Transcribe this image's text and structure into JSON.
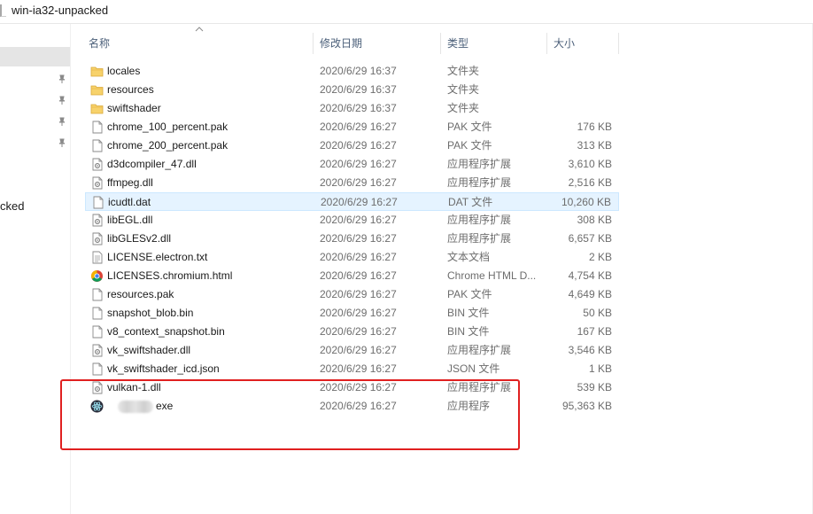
{
  "window": {
    "title": "win-ia32-unpacked"
  },
  "nav": {
    "partial_label": "cked"
  },
  "columns": {
    "name": "名称",
    "date": "修改日期",
    "type": "类型",
    "size": "大小"
  },
  "files": [
    {
      "name": "locales",
      "date": "2020/6/29 16:37",
      "type": "文件夹",
      "size": "",
      "icon": "folder-icon"
    },
    {
      "name": "resources",
      "date": "2020/6/29 16:37",
      "type": "文件夹",
      "size": "",
      "icon": "folder-icon"
    },
    {
      "name": "swiftshader",
      "date": "2020/6/29 16:37",
      "type": "文件夹",
      "size": "",
      "icon": "folder-icon"
    },
    {
      "name": "chrome_100_percent.pak",
      "date": "2020/6/29 16:27",
      "type": "PAK 文件",
      "size": "176 KB",
      "icon": "file-icon"
    },
    {
      "name": "chrome_200_percent.pak",
      "date": "2020/6/29 16:27",
      "type": "PAK 文件",
      "size": "313 KB",
      "icon": "file-icon"
    },
    {
      "name": "d3dcompiler_47.dll",
      "date": "2020/6/29 16:27",
      "type": "应用程序扩展",
      "size": "3,610 KB",
      "icon": "dll-icon"
    },
    {
      "name": "ffmpeg.dll",
      "date": "2020/6/29 16:27",
      "type": "应用程序扩展",
      "size": "2,516 KB",
      "icon": "dll-icon"
    },
    {
      "name": "icudtl.dat",
      "date": "2020/6/29 16:27",
      "type": "DAT 文件",
      "size": "10,260 KB",
      "icon": "file-icon"
    },
    {
      "name": "libEGL.dll",
      "date": "2020/6/29 16:27",
      "type": "应用程序扩展",
      "size": "308 KB",
      "icon": "dll-icon"
    },
    {
      "name": "libGLESv2.dll",
      "date": "2020/6/29 16:27",
      "type": "应用程序扩展",
      "size": "6,657 KB",
      "icon": "dll-icon"
    },
    {
      "name": "LICENSE.electron.txt",
      "date": "2020/6/29 16:27",
      "type": "文本文档",
      "size": "2 KB",
      "icon": "text-file-icon"
    },
    {
      "name": "LICENSES.chromium.html",
      "date": "2020/6/29 16:27",
      "type": "Chrome HTML D...",
      "size": "4,754 KB",
      "icon": "chrome-icon"
    },
    {
      "name": "resources.pak",
      "date": "2020/6/29 16:27",
      "type": "PAK 文件",
      "size": "4,649 KB",
      "icon": "file-icon"
    },
    {
      "name": "snapshot_blob.bin",
      "date": "2020/6/29 16:27",
      "type": "BIN 文件",
      "size": "50 KB",
      "icon": "file-icon"
    },
    {
      "name": "v8_context_snapshot.bin",
      "date": "2020/6/29 16:27",
      "type": "BIN 文件",
      "size": "167 KB",
      "icon": "file-icon"
    },
    {
      "name": "vk_swiftshader.dll",
      "date": "2020/6/29 16:27",
      "type": "应用程序扩展",
      "size": "3,546 KB",
      "icon": "dll-icon"
    },
    {
      "name": "vk_swiftshader_icd.json",
      "date": "2020/6/29 16:27",
      "type": "JSON 文件",
      "size": "1 KB",
      "icon": "file-icon"
    },
    {
      "name": "vulkan-1.dll",
      "date": "2020/6/29 16:27",
      "type": "应用程序扩展",
      "size": "539 KB",
      "icon": "dll-icon"
    },
    {
      "name": "exe",
      "date": "2020/6/29 16:27",
      "type": "应用程序",
      "size": "95,363 KB",
      "icon": "electron-app-icon"
    }
  ],
  "selected_index": 7
}
